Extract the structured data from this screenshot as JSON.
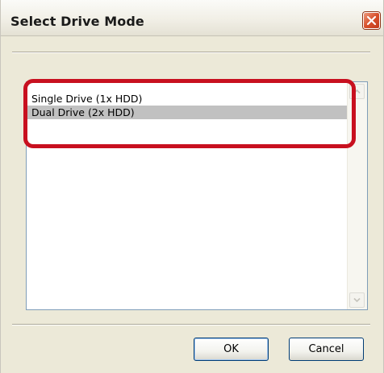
{
  "window": {
    "title": "Select Drive Mode",
    "close_icon": "close-icon"
  },
  "list": {
    "items": [
      {
        "label": "Single Drive (1x HDD)",
        "selected": false
      },
      {
        "label": "Dual Drive (2x HDD)",
        "selected": true
      }
    ],
    "highlight_color": "#c8101f",
    "selection_color": "#c1c1c1"
  },
  "buttons": {
    "ok_label": "OK",
    "cancel_label": "Cancel"
  },
  "colors": {
    "dialog_bg": "#ece9d8",
    "close_button": "#d8502c",
    "list_border": "#7f9db9"
  }
}
